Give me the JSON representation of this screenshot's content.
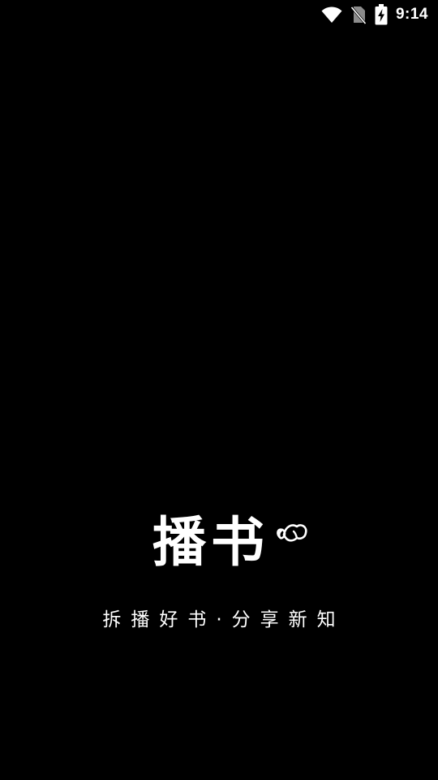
{
  "status_bar": {
    "time": "9:14",
    "icons": [
      "wifi-icon",
      "no-sim-icon",
      "battery-charging-icon"
    ]
  },
  "splash": {
    "logo_text": "播书",
    "logo_mark_icon": "loop-knot-icon",
    "tagline": "拆播好书·分享新知"
  },
  "colors": {
    "background": "#000000",
    "foreground": "#ffffff"
  }
}
